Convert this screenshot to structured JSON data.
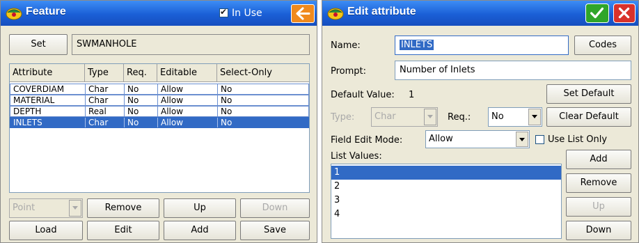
{
  "colors": {
    "title_blue": "#1a5fd6",
    "selection": "#316ac5",
    "ok_green": "#2fa52a",
    "cancel_red": "#d9322b",
    "back_orange": "#f08a1e"
  },
  "feature": {
    "title": "Feature",
    "in_use_label": "In Use",
    "in_use_checked": true,
    "back_icon": "arrow-left-icon",
    "set_label": "Set",
    "feature_code": "SWMANHOLE",
    "table": {
      "headers": [
        "Attribute",
        "Type",
        "Req.",
        "Editable",
        "Select-Only"
      ],
      "rows": [
        {
          "attribute": "COVERDIAM",
          "type": "Char",
          "req": "No",
          "editable": "Allow",
          "select_only": "No"
        },
        {
          "attribute": "MATERIAL",
          "type": "Char",
          "req": "No",
          "editable": "Allow",
          "select_only": "No"
        },
        {
          "attribute": "DEPTH",
          "type": "Real",
          "req": "No",
          "editable": "Allow",
          "select_only": "No"
        },
        {
          "attribute": "INLETS",
          "type": "Char",
          "req": "No",
          "editable": "Allow",
          "select_only": "No"
        }
      ],
      "selected_row": 3
    },
    "geometry_select": "Point",
    "buttons": {
      "remove": "Remove",
      "up": "Up",
      "down": "Down",
      "load": "Load",
      "edit": "Edit",
      "add": "Add",
      "save": "Save"
    }
  },
  "edit_attribute": {
    "title": "Edit attribute",
    "ok_icon": "checkmark-icon",
    "cancel_icon": "close-icon",
    "name_label": "Name:",
    "name_value": "INLETS",
    "codes_button": "Codes",
    "prompt_label": "Prompt:",
    "prompt_value": "Number of Inlets",
    "default_label": "Default Value:",
    "default_value": "1",
    "set_default_button": "Set Default",
    "type_label": "Type:",
    "type_value": "Char",
    "req_label": "Req.:",
    "req_value": "No",
    "clear_default_button": "Clear Default",
    "field_edit_label": "Field Edit Mode:",
    "field_edit_value": "Allow",
    "use_list_only_label": "Use List Only",
    "use_list_only_checked": false,
    "list_values_label": "List Values:",
    "list_values": [
      "1",
      "2",
      "3",
      "4"
    ],
    "selected_value": 0,
    "buttons": {
      "add": "Add",
      "remove": "Remove",
      "up": "Up",
      "down": "Down"
    }
  }
}
